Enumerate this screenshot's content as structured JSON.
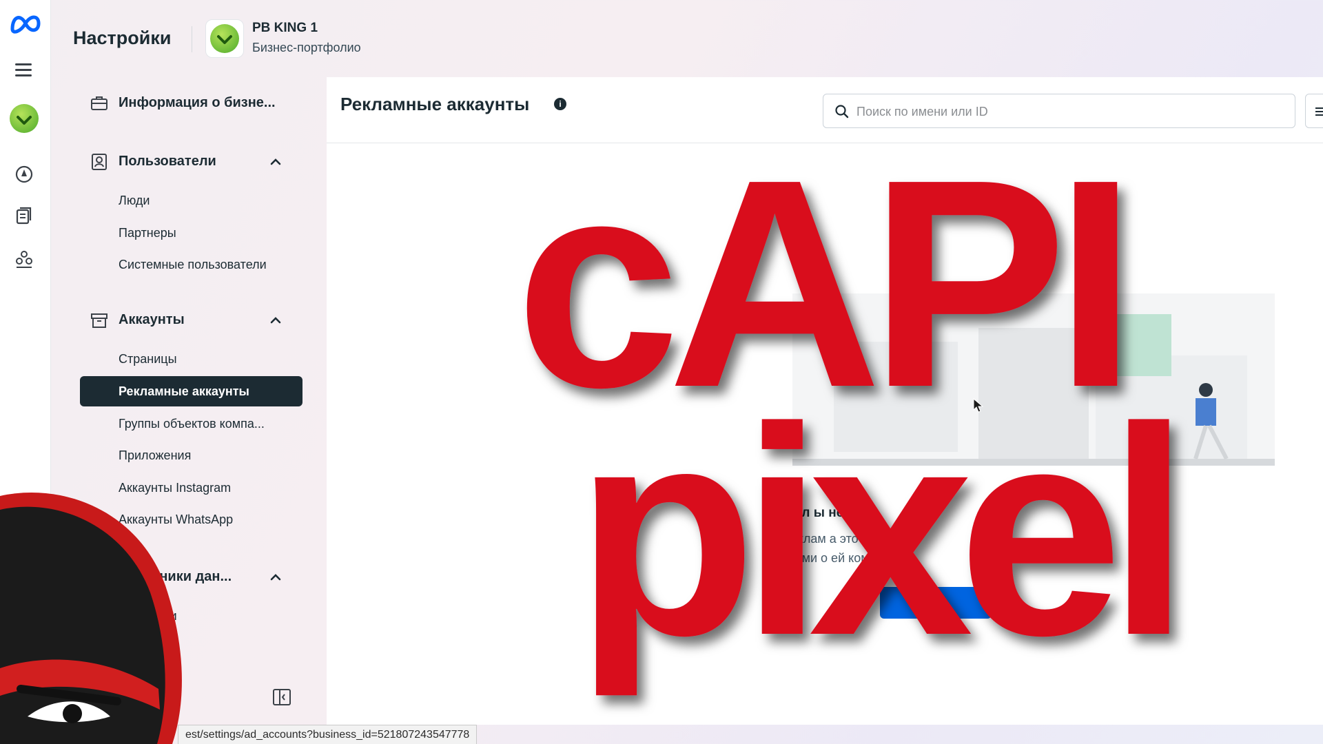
{
  "header": {
    "title": "Настройки",
    "business_name": "PB KING 1",
    "business_type": "Бизнес-портфолио"
  },
  "sidebar": {
    "business_info": "Информация о бизне...",
    "users_section": "Пользователи",
    "users_items": [
      "Люди",
      "Партнеры",
      "Системные пользователи"
    ],
    "accounts_section": "Аккаунты",
    "accounts_items": [
      "Страницы",
      "Рекламные аккаунты",
      "Группы объектов компа...",
      "Приложения",
      "Аккаунты Instagram",
      "Аккаунты WhatsApp"
    ],
    "data_sources_section": "очники дан...",
    "data_sources_items": [
      "ги",
      "и"
    ]
  },
  "main": {
    "title": "Рекламные аккаунты",
    "search_placeholder": "Поиск по имени или ID",
    "empty_title": "Рекл                  ы не д         ы",
    "empty_desc_line1": "те реклам           а это биз",
    "empty_desc_line2": "ть всеми о          ей компа",
    "empty_button": "+                ь"
  },
  "status_url": "est/settings/ad_accounts?business_id=521807243547778",
  "overlay": {
    "line1": "cAPI",
    "line2": "pixel",
    "color": "#d9091f"
  },
  "colors": {
    "accent": "#0064e0",
    "active_nav_bg": "#1c2b33",
    "brand_green": "#4caa2a"
  }
}
